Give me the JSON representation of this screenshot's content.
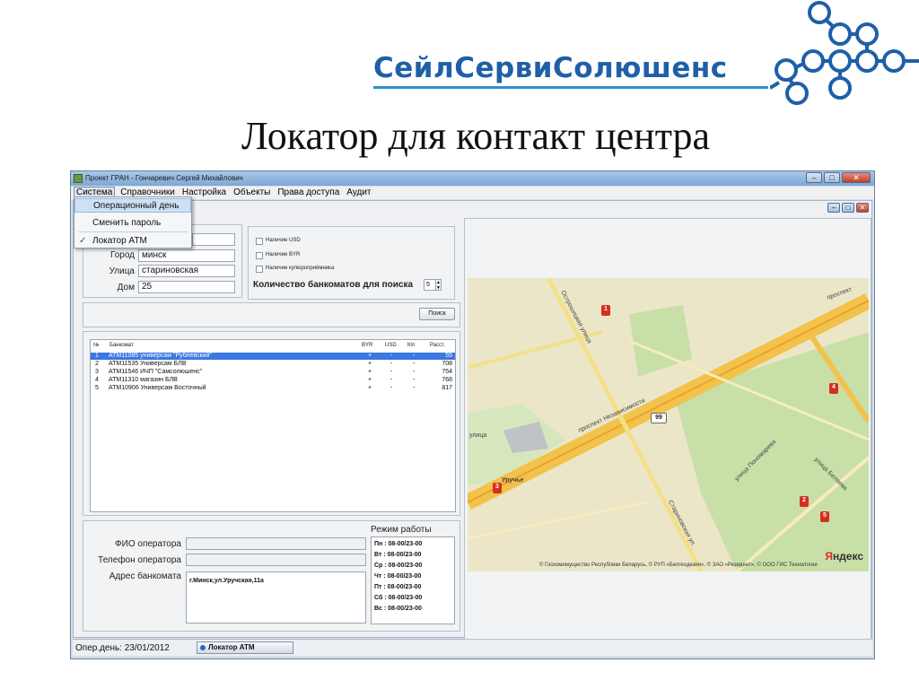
{
  "slide": {
    "logo_text": "СейлСервиСолюшенс",
    "title": "Локатор для контакт центра"
  },
  "window": {
    "title": "Проект ГРАН - Гончаревич Сергей Михайлович",
    "menu": [
      "Система",
      "Справочники",
      "Настройка",
      "Объекты",
      "Права доступа",
      "Аудит"
    ]
  },
  "dropdown": {
    "items": [
      "Операционный день",
      "Сменить пароль",
      "Локатор ATM"
    ],
    "checked_glyph": "✓"
  },
  "search": {
    "city_label": "Город",
    "city_value": "минск",
    "street_label": "Улица",
    "street_value": "стариновская",
    "house_label": "Дом",
    "house_value": "25",
    "top_value": "",
    "checks": [
      "Наличие USD",
      "Наличие BYR",
      "Наличие купюроприёмника"
    ],
    "count_label": "Количество банкоматов для поиска",
    "count_value": "5",
    "search_button": "Поиск"
  },
  "table": {
    "headers": [
      "№",
      "Банкомат",
      "BYR",
      "USD",
      "К/п",
      "Расст."
    ],
    "rows": [
      [
        "1",
        "ATM11085 универсам \"Рублевский\"",
        "+",
        "-",
        "-",
        "55"
      ],
      [
        "2",
        "ATM11535 Универсам БЛВ",
        "+",
        "-",
        "-",
        "708"
      ],
      [
        "3",
        "ATM11546 ИЧП \"Самсолюшенс\"",
        "+",
        "-",
        "-",
        "754"
      ],
      [
        "4",
        "ATM11310 магазин БЛВ",
        "+",
        "-",
        "-",
        "768"
      ],
      [
        "5",
        "ATM10906 Универсам Восточный",
        "+",
        "-",
        "-",
        "817"
      ]
    ]
  },
  "operator": {
    "fio_label": "ФИО оператора",
    "phone_label": "Телефон оператора",
    "address_label": "Адрес банкомата",
    "address_value": "г.Минск,ул.Уручская,11а"
  },
  "schedule": {
    "title": "Режим работы",
    "lines": [
      "Пн : 08-00/23-00",
      "Вт : 08-00/23-00",
      "Ср : 08-00/23-00",
      "Чт : 08-00/23-00",
      "Пт : 08-00/23-00",
      "Сб : 08-00/23-00",
      "Вс : 08-00/23-00"
    ]
  },
  "map": {
    "street_labels": [
      "Острошицкая улица",
      "проспект Независимости",
      "Уручье",
      "Стариновская ул.",
      "улица Пономарева",
      "улица Беляева",
      "проспект",
      "улица"
    ],
    "marker_labels": [
      "1",
      "2",
      "3",
      "4",
      "5"
    ],
    "cluster_label": "99",
    "copyright": "© Госкомимущество Республики Беларусь, © РУП «Белгеодезия», © ЗАО «Резидент», © ООО ГИС Технологии",
    "brand_y": "Я",
    "brand_rest": "ндекс"
  },
  "statusbar": {
    "date_text": "Опер.день: 23/01/2012",
    "task_label": "Локатор ATM"
  },
  "colors": {
    "accent": "#1f5fa8",
    "selection": "#3b78e0",
    "marker": "#d62f20",
    "road": "#f3c24a"
  }
}
